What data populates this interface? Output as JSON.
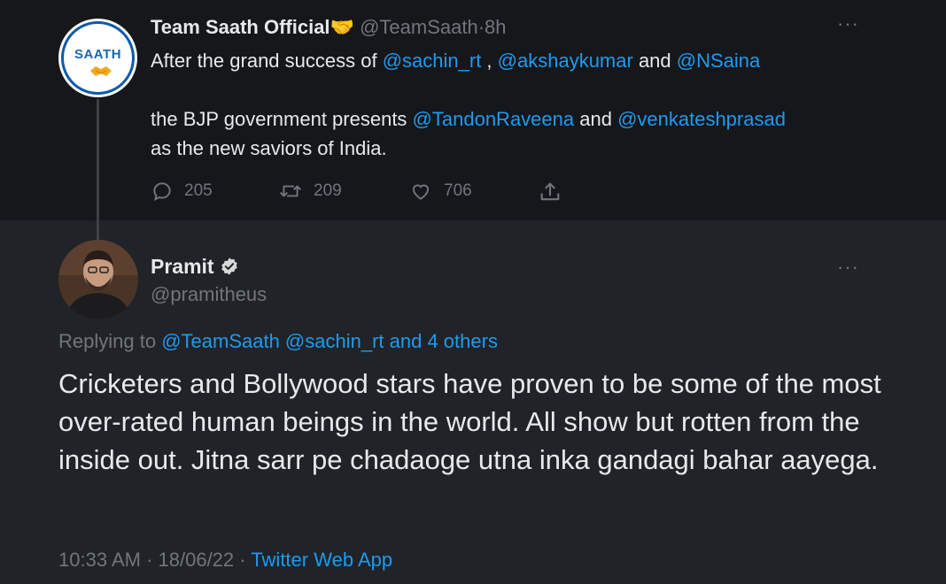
{
  "parent": {
    "display_name": "Team Saath Official",
    "emoji": "🤝",
    "handle": "@TeamSaath",
    "separator": "·",
    "time": "8h",
    "avatar_text": "SAATH",
    "more": "···",
    "line1": {
      "t1": "After the grand success of ",
      "m1": "@sachin_rt",
      "t2": " , ",
      "m2": "@akshaykumar",
      "t3": " and ",
      "m3": "@NSaina"
    },
    "line2": {
      "t1": "the BJP government presents ",
      "m1": "@TandonRaveena",
      "t2": " and ",
      "m2": "@venkateshprasad"
    },
    "line3": "as the new saviors of India.",
    "stats": {
      "replies": "205",
      "retweets": "209",
      "likes": "706"
    }
  },
  "reply": {
    "display_name": "Pramit",
    "handle": "@pramitheus",
    "more": "···",
    "replying_prefix": "Replying to ",
    "replying_to": "@TeamSaath @sachin_rt and 4 others",
    "body": "Cricketers and Bollywood stars have proven to be some of the most over-rated human beings in the world. All show but rotten from the inside out. Jitna sarr pe chadaoge utna inka gandagi bahar aayega.",
    "time": "10:33 AM",
    "dot": " · ",
    "date": "18/06/22",
    "dot2": " · ",
    "source": "Twitter Web App"
  },
  "colors": {
    "link": "#1d9bf0",
    "muted": "#71767b",
    "text": "#e7e9ea",
    "parent_bg": "#15171b",
    "page_bg": "#202327"
  },
  "icons": [
    "reply-icon",
    "retweet-icon",
    "like-icon",
    "share-icon",
    "verified-badge-icon",
    "more-icon",
    "handshake-icon"
  ]
}
